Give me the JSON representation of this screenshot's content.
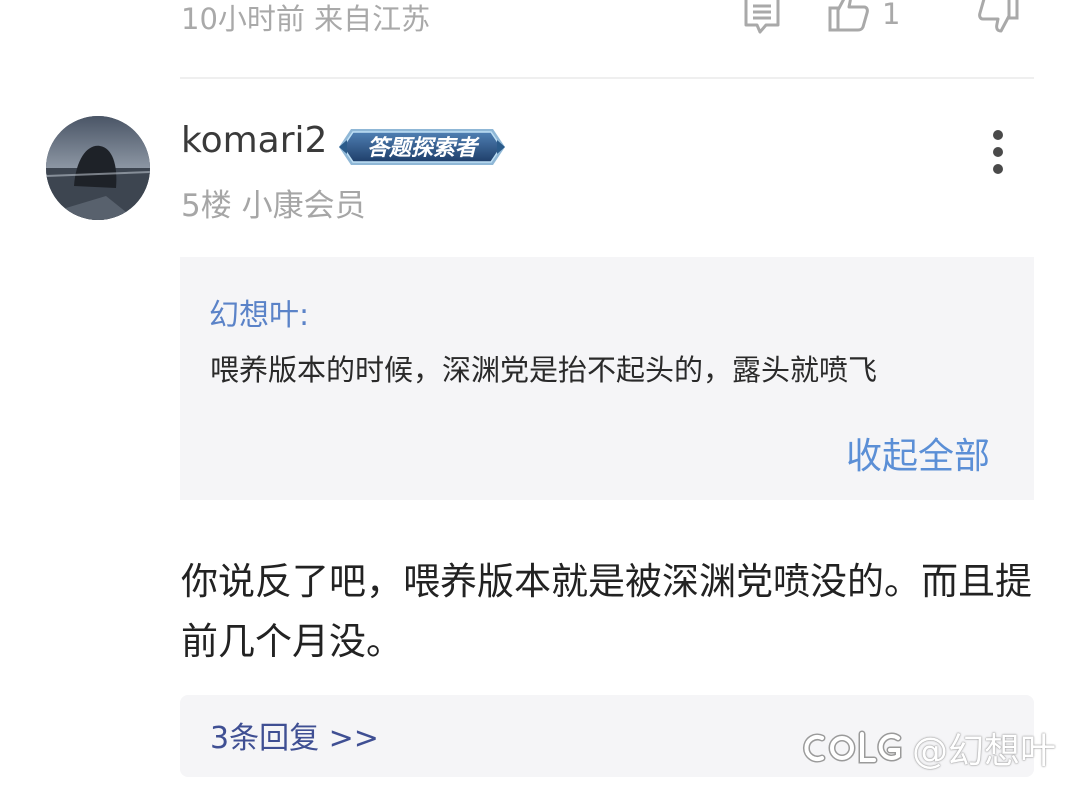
{
  "prev_comment": {
    "meta": "10小时前 来自江苏",
    "like_count": "1",
    "icons": {
      "reply": "comment-icon",
      "like": "thumbs-up-icon",
      "dislike": "thumbs-down-icon"
    }
  },
  "comment": {
    "username": "komari2",
    "badge": "答题探索者",
    "floor_info": "5楼 小康会员",
    "more_icon": "more-vertical-icon",
    "quote": {
      "author": "幻想叶:",
      "text": "喂养版本的时候，深渊党是抬不起头的，露头就喷飞",
      "collapse_label": "收起全部"
    },
    "body": "你说反了吧，喂养版本就是被深渊党喷没的。而且提前几个月没。",
    "replies_label": "3条回复 >>"
  },
  "watermark": {
    "logo": "COLG",
    "text": "@幻想叶"
  },
  "colors": {
    "meta_gray": "#a9a9a9",
    "quote_author": "#5b83c8",
    "collapse_link": "#5b8fd6",
    "replies_link": "#3f4f93",
    "panel_bg": "#f5f5f7"
  }
}
